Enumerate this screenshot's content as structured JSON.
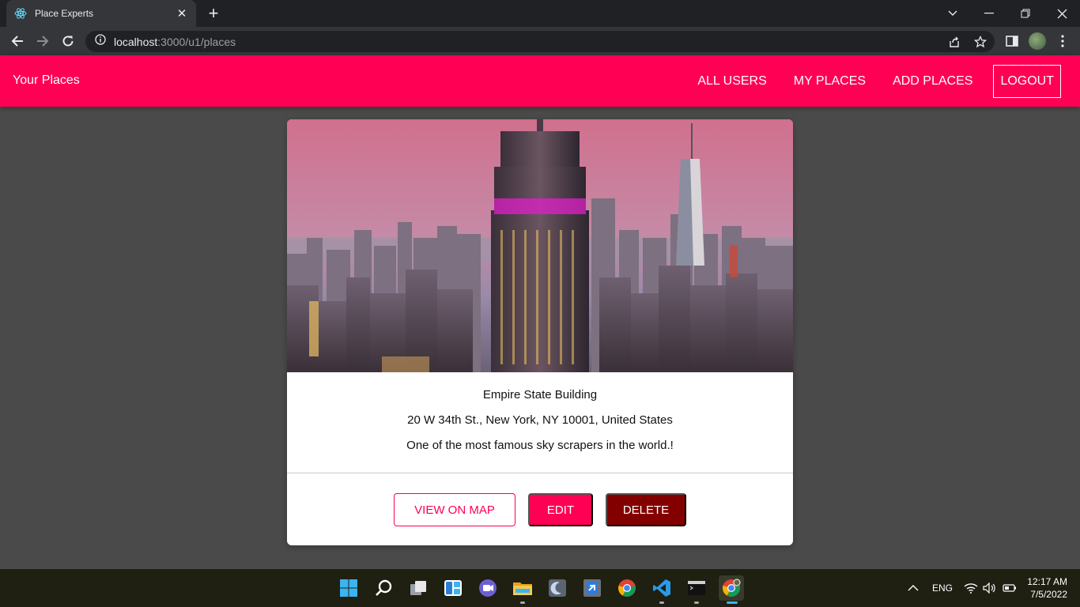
{
  "browser": {
    "tab_title": "Place Experts",
    "url_host": "localhost",
    "url_path": ":3000/u1/places"
  },
  "app": {
    "brand": "Your Places",
    "nav": {
      "all_users": "ALL USERS",
      "my_places": "MY PLACES",
      "add_places": "ADD PLACES",
      "logout": "LOGOUT"
    },
    "accent_color": "#ff0055",
    "delete_color": "#830000"
  },
  "place": {
    "title": "Empire State Building",
    "address": "20 W 34th St., New York, NY 10001, United States",
    "description": "One of the most famous sky scrapers in the world.!",
    "actions": {
      "view_on_map": "VIEW ON MAP",
      "edit": "EDIT",
      "delete": "DELETE"
    }
  },
  "taskbar": {
    "language": "ENG",
    "time": "12:17 AM",
    "date": "7/5/2022",
    "pinned_icons": [
      "windows-start-icon",
      "search-icon",
      "task-view-icon",
      "widgets-icon",
      "teams-chat-icon",
      "file-explorer-icon",
      "moon-app-icon",
      "editor-app-icon",
      "chrome-icon",
      "vscode-icon",
      "terminal-icon",
      "chrome-profile-icon"
    ]
  }
}
